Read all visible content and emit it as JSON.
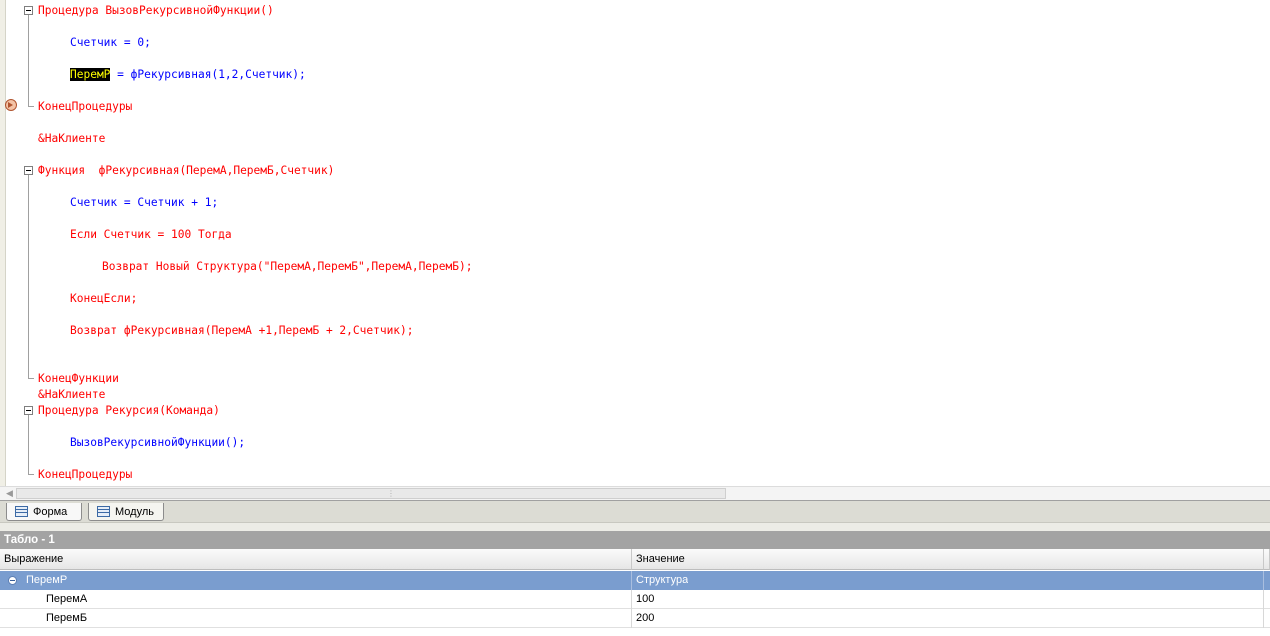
{
  "editor": {
    "lines": [
      {
        "text": "Процедура ВызовРекурсивнойФункции()"
      },
      {
        "text": "Счетчик = 0;"
      },
      {
        "highlight": "ПеремР",
        "rest": " = фРекурсивная(1,2,Счетчик);"
      },
      {
        "text": "КонецПроцедуры"
      },
      {
        "text": "&НаКлиенте"
      },
      {
        "text": "Функция  фРекурсивная(ПеремА,ПеремБ,Счетчик)"
      },
      {
        "text": "Счетчик = Счетчик + 1;"
      },
      {
        "text": "Если Счетчик = 100 Тогда"
      },
      {
        "text": "Возврат Новый Структура(\"ПеремА,ПеремБ\",ПеремА,ПеремБ);"
      },
      {
        "text": "КонецЕсли;"
      },
      {
        "text": "Возврат фРекурсивная(ПеремА +1,ПеремБ + 2,Счетчик);"
      },
      {
        "text": "КонецФункции"
      },
      {
        "text": "&НаКлиенте"
      },
      {
        "text": "Процедура Рекурсия(Команда)"
      },
      {
        "text": "ВызовРекурсивнойФункции();"
      },
      {
        "text": "КонецПроцедуры"
      }
    ]
  },
  "tabs": [
    {
      "label": "Форма",
      "icon": "form-icon"
    },
    {
      "label": "Модуль",
      "icon": "module-icon"
    }
  ],
  "panel": {
    "title": "Табло - 1",
    "columns": [
      "Выражение",
      "Значение"
    ],
    "rows": [
      {
        "expr": "ПеремР",
        "value": "Структура",
        "selected": true
      },
      {
        "expr": "ПеремА",
        "value": "100",
        "selected": false
      },
      {
        "expr": "ПеремБ",
        "value": "200",
        "selected": false
      }
    ]
  },
  "colors": {
    "keyword": "#ff0000",
    "identifier": "#0000ff",
    "selection": "#7a9dcf",
    "panel_header": "#a3a3a3"
  }
}
